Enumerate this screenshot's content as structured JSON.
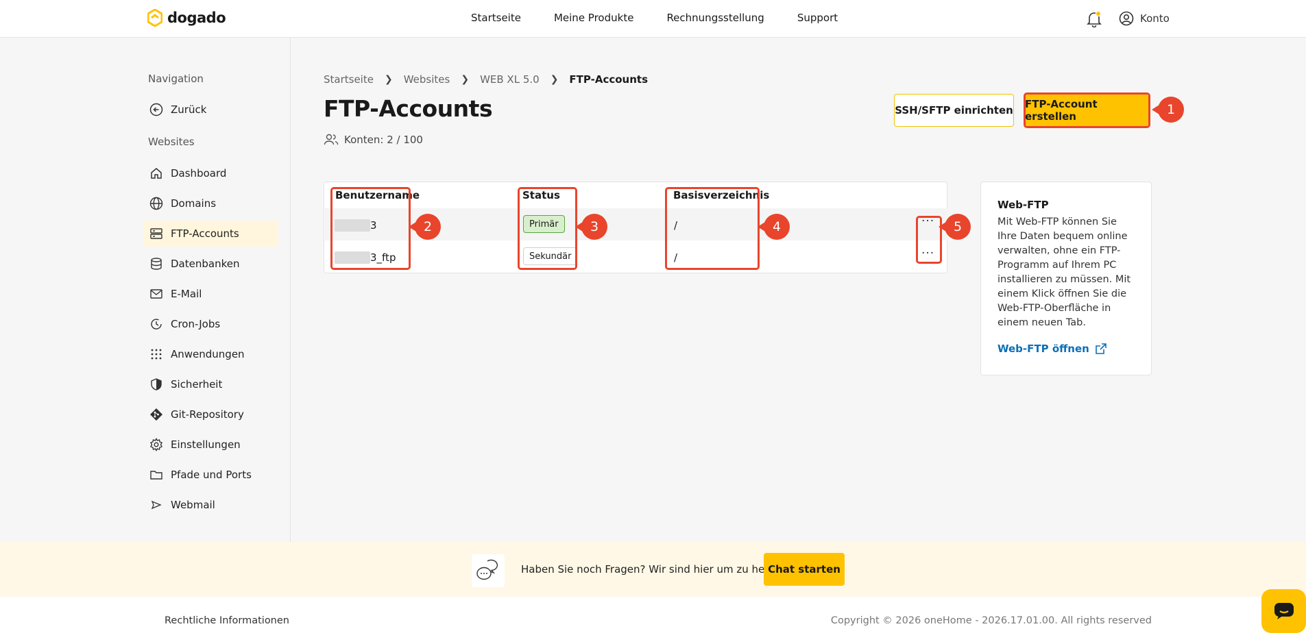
{
  "header": {
    "brand": "dogado",
    "nav": [
      "Startseite",
      "Meine Produkte",
      "Rechnungsstellung",
      "Support"
    ],
    "account_label": "Konto"
  },
  "sidebar": {
    "heading_navigation": "Navigation",
    "back_label": "Zurück",
    "heading_websites": "Websites",
    "items": [
      {
        "label": "Dashboard",
        "icon": "home-icon"
      },
      {
        "label": "Domains",
        "icon": "globe-icon"
      },
      {
        "label": "FTP-Accounts",
        "icon": "server-icon",
        "active": true
      },
      {
        "label": "Datenbanken",
        "icon": "database-icon"
      },
      {
        "label": "E-Mail",
        "icon": "mail-icon"
      },
      {
        "label": "Cron-Jobs",
        "icon": "clock-icon"
      },
      {
        "label": "Anwendungen",
        "icon": "grid-icon"
      },
      {
        "label": "Sicherheit",
        "icon": "shield-icon"
      },
      {
        "label": "Git-Repository",
        "icon": "git-icon"
      },
      {
        "label": "Einstellungen",
        "icon": "gear-icon"
      },
      {
        "label": "Pfade und Ports",
        "icon": "folder-icon"
      },
      {
        "label": "Webmail",
        "icon": "send-icon"
      }
    ]
  },
  "breadcrumb": [
    "Startseite",
    "Websites",
    "WEB XL 5.0",
    "FTP-Accounts"
  ],
  "page": {
    "title": "FTP-Accounts",
    "accounts_count": "Konten: 2 / 100",
    "ssh_button": "SSH/SFTP einrichten",
    "create_button": "FTP-Account erstellen"
  },
  "table": {
    "columns": [
      "Benutzername",
      "Status",
      "Basisverzeichnis"
    ],
    "rows": [
      {
        "username_suffix": "3",
        "status": "Primär",
        "path": "/",
        "actions": "···"
      },
      {
        "username_suffix": "3_ftp",
        "status": "Sekundär",
        "path": "/",
        "actions": "···"
      }
    ]
  },
  "annotations": [
    "1",
    "2",
    "3",
    "4",
    "5"
  ],
  "web_ftp": {
    "title": "Web-FTP",
    "text": "Mit Web-FTP können Sie Ihre Daten bequem online verwalten, ohne ein FTP-Programm auf Ihrem PC installieren zu müssen. Mit einem Klick öffnen Sie die Web-FTP-Oberfläche in einem neuen Tab.",
    "link": "Web-FTP öffnen"
  },
  "help": {
    "text": "Haben Sie noch Fragen? Wir sind hier um zu helfen.",
    "button": "Chat starten"
  },
  "footer": {
    "legal": "Rechtliche Informationen",
    "copyright": "Copyright © 2026 oneHome - 2026.17.01.00. All rights reserved"
  },
  "colors": {
    "accent": "#ffc200",
    "annotation": "#e8452c",
    "link": "#0b6fb8"
  }
}
